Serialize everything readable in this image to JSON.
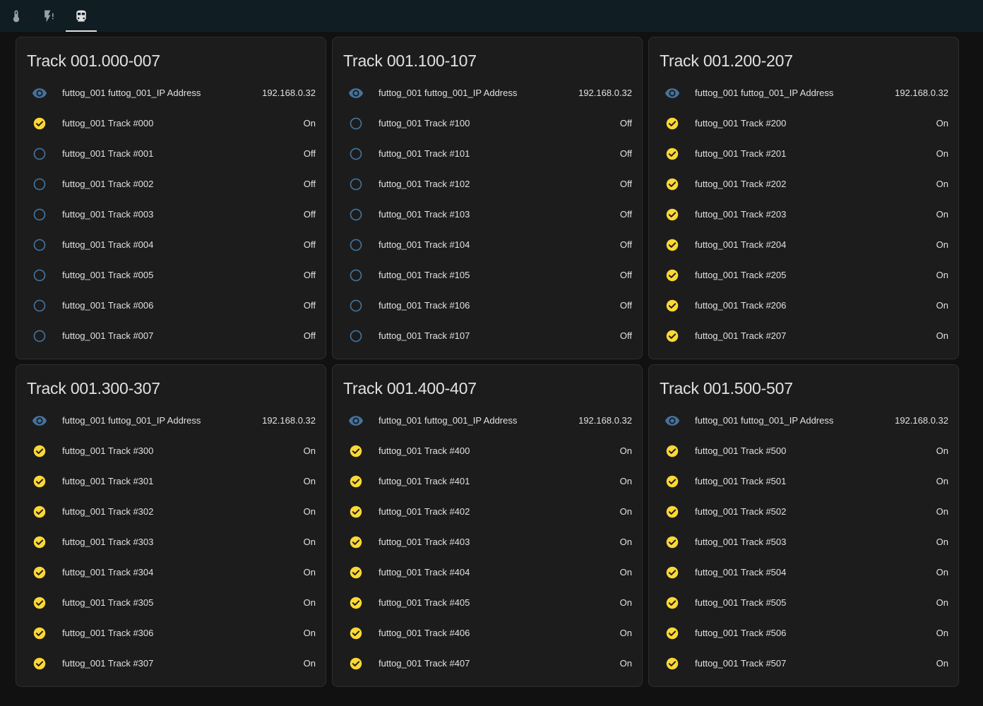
{
  "colors": {
    "background": "#111111",
    "topbar": "#101e24",
    "card": "#1c1c1c",
    "text": "#e1e1e1",
    "on_icon": "#fdd835",
    "off_icon": "#44739e",
    "eye_icon": "#44739e"
  },
  "tabs": [
    {
      "icon": "thermometer-icon"
    },
    {
      "icon": "flash-alert-icon"
    },
    {
      "icon": "train-icon",
      "active": true
    }
  ],
  "cards": [
    {
      "title": "Track 001.000-007",
      "ip": {
        "label": "futtog_001 futtog_001_IP Address",
        "value": "192.168.0.32"
      },
      "tracks": [
        {
          "label": "futtog_001 Track #000",
          "state": "On"
        },
        {
          "label": "futtog_001 Track #001",
          "state": "Off"
        },
        {
          "label": "futtog_001 Track #002",
          "state": "Off"
        },
        {
          "label": "futtog_001 Track #003",
          "state": "Off"
        },
        {
          "label": "futtog_001 Track #004",
          "state": "Off"
        },
        {
          "label": "futtog_001 Track #005",
          "state": "Off"
        },
        {
          "label": "futtog_001 Track #006",
          "state": "Off"
        },
        {
          "label": "futtog_001 Track #007",
          "state": "Off"
        }
      ]
    },
    {
      "title": "Track 001.100-107",
      "ip": {
        "label": "futtog_001 futtog_001_IP Address",
        "value": "192.168.0.32"
      },
      "tracks": [
        {
          "label": "futtog_001 Track #100",
          "state": "Off"
        },
        {
          "label": "futtog_001 Track #101",
          "state": "Off"
        },
        {
          "label": "futtog_001 Track #102",
          "state": "Off"
        },
        {
          "label": "futtog_001 Track #103",
          "state": "Off"
        },
        {
          "label": "futtog_001 Track #104",
          "state": "Off"
        },
        {
          "label": "futtog_001 Track #105",
          "state": "Off"
        },
        {
          "label": "futtog_001 Track #106",
          "state": "Off"
        },
        {
          "label": "futtog_001 Track #107",
          "state": "Off"
        }
      ]
    },
    {
      "title": "Track 001.200-207",
      "ip": {
        "label": "futtog_001 futtog_001_IP Address",
        "value": "192.168.0.32"
      },
      "tracks": [
        {
          "label": "futtog_001 Track #200",
          "state": "On"
        },
        {
          "label": "futtog_001 Track #201",
          "state": "On"
        },
        {
          "label": "futtog_001 Track #202",
          "state": "On"
        },
        {
          "label": "futtog_001 Track #203",
          "state": "On"
        },
        {
          "label": "futtog_001 Track #204",
          "state": "On"
        },
        {
          "label": "futtog_001 Track #205",
          "state": "On"
        },
        {
          "label": "futtog_001 Track #206",
          "state": "On"
        },
        {
          "label": "futtog_001 Track #207",
          "state": "On"
        }
      ]
    },
    {
      "title": "Track 001.300-307",
      "ip": {
        "label": "futtog_001 futtog_001_IP Address",
        "value": "192.168.0.32"
      },
      "tracks": [
        {
          "label": "futtog_001 Track #300",
          "state": "On"
        },
        {
          "label": "futtog_001 Track #301",
          "state": "On"
        },
        {
          "label": "futtog_001 Track #302",
          "state": "On"
        },
        {
          "label": "futtog_001 Track #303",
          "state": "On"
        },
        {
          "label": "futtog_001 Track #304",
          "state": "On"
        },
        {
          "label": "futtog_001 Track #305",
          "state": "On"
        },
        {
          "label": "futtog_001 Track #306",
          "state": "On"
        },
        {
          "label": "futtog_001 Track #307",
          "state": "On"
        }
      ]
    },
    {
      "title": "Track 001.400-407",
      "ip": {
        "label": "futtog_001 futtog_001_IP Address",
        "value": "192.168.0.32"
      },
      "tracks": [
        {
          "label": "futtog_001 Track #400",
          "state": "On"
        },
        {
          "label": "futtog_001 Track #401",
          "state": "On"
        },
        {
          "label": "futtog_001 Track #402",
          "state": "On"
        },
        {
          "label": "futtog_001 Track #403",
          "state": "On"
        },
        {
          "label": "futtog_001 Track #404",
          "state": "On"
        },
        {
          "label": "futtog_001 Track #405",
          "state": "On"
        },
        {
          "label": "futtog_001 Track #406",
          "state": "On"
        },
        {
          "label": "futtog_001 Track #407",
          "state": "On"
        }
      ]
    },
    {
      "title": "Track 001.500-507",
      "ip": {
        "label": "futtog_001 futtog_001_IP Address",
        "value": "192.168.0.32"
      },
      "tracks": [
        {
          "label": "futtog_001 Track #500",
          "state": "On"
        },
        {
          "label": "futtog_001 Track #501",
          "state": "On"
        },
        {
          "label": "futtog_001 Track #502",
          "state": "On"
        },
        {
          "label": "futtog_001 Track #503",
          "state": "On"
        },
        {
          "label": "futtog_001 Track #504",
          "state": "On"
        },
        {
          "label": "futtog_001 Track #505",
          "state": "On"
        },
        {
          "label": "futtog_001 Track #506",
          "state": "On"
        },
        {
          "label": "futtog_001 Track #507",
          "state": "On"
        }
      ]
    }
  ]
}
